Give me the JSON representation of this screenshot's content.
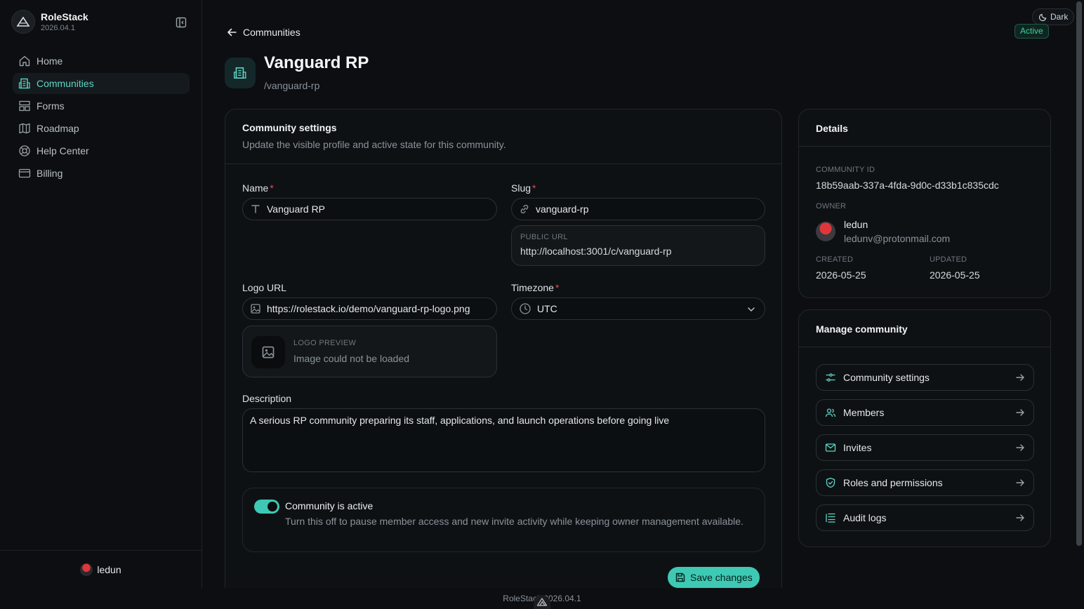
{
  "app": {
    "name": "RoleStack",
    "version": "2026.04.1"
  },
  "sidebar": {
    "items": [
      {
        "label": "Home",
        "icon": "home-icon"
      },
      {
        "label": "Communities",
        "icon": "building-icon",
        "active": true
      },
      {
        "label": "Forms",
        "icon": "layout-icon"
      },
      {
        "label": "Roadmap",
        "icon": "map-icon"
      },
      {
        "label": "Help Center",
        "icon": "lifebuoy-icon"
      },
      {
        "label": "Billing",
        "icon": "credit-card-icon"
      }
    ],
    "user": "ledun"
  },
  "header": {
    "back_label": "Communities",
    "theme_label": "Dark",
    "status": "Active",
    "title": "Vanguard RP",
    "slug": "/vanguard-rp"
  },
  "settings": {
    "title": "Community settings",
    "subtitle": "Update the visible profile and active state for this community.",
    "name": {
      "label": "Name",
      "value": "Vanguard RP"
    },
    "slug": {
      "label": "Slug",
      "value": "vanguard-rp"
    },
    "public_url": {
      "caption": "PUBLIC URL",
      "value": "http://localhost:3001/c/vanguard-rp"
    },
    "logo_url": {
      "label": "Logo URL",
      "value": "https://rolestack.io/demo/vanguard-rp-logo.png"
    },
    "logo_preview": {
      "caption": "LOGO PREVIEW",
      "message": "Image could not be loaded"
    },
    "timezone": {
      "label": "Timezone",
      "value": "UTC"
    },
    "description": {
      "label": "Description",
      "value": "A serious RP community preparing its staff, applications, and launch operations before going live"
    },
    "active": {
      "label": "Community is active",
      "help": "Turn this off to pause member access and new invite activity while keeping owner management available.",
      "enabled": true
    },
    "save_label": "Save changes"
  },
  "details": {
    "title": "Details",
    "id_label": "COMMUNITY ID",
    "id_value": "18b59aab-337a-4fda-9d0c-d33b1c835cdc",
    "owner_label": "OWNER",
    "owner_name": "ledun",
    "owner_email": "ledunv@protonmail.com",
    "created_label": "CREATED",
    "created_value": "2026-05-25",
    "updated_label": "UPDATED",
    "updated_value": "2026-05-25"
  },
  "manage": {
    "title": "Manage community",
    "items": [
      {
        "label": "Community settings",
        "icon": "sliders-icon"
      },
      {
        "label": "Members",
        "icon": "users-icon"
      },
      {
        "label": "Invites",
        "icon": "mail-icon"
      },
      {
        "label": "Roles and permissions",
        "icon": "shield-icon"
      },
      {
        "label": "Audit logs",
        "icon": "logs-icon"
      }
    ]
  },
  "footer": {
    "text": "RoleStack 2026.04.1"
  },
  "colors": {
    "accent": "#3ec9b4",
    "background": "#0c0e11",
    "required": "#e5484d",
    "active_badge": "#3ed39a"
  }
}
